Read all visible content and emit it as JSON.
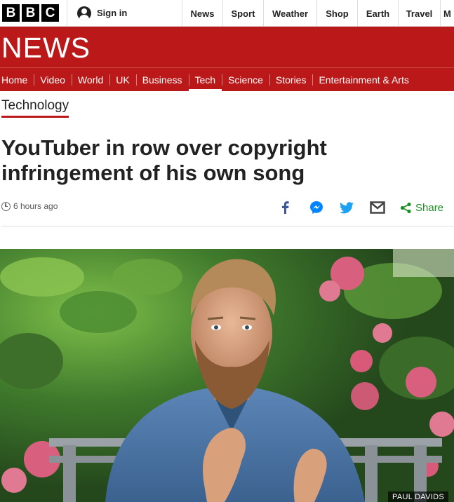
{
  "topbar": {
    "logo_letters": [
      "B",
      "B",
      "C"
    ],
    "signin_label": "Sign in",
    "links": [
      "News",
      "Sport",
      "Weather",
      "Shop",
      "Earth",
      "Travel",
      "M"
    ]
  },
  "banner": {
    "title": "NEWS",
    "color": "#bb1919"
  },
  "nav": {
    "items": [
      "Home",
      "Video",
      "World",
      "UK",
      "Business",
      "Tech",
      "Science",
      "Stories",
      "Entertainment & Arts"
    ],
    "active": "Tech"
  },
  "article": {
    "section": "Technology",
    "headline": "YouTuber in row over copyright infringement of his own song",
    "timestamp": "6 hours ago",
    "share_label": "Share",
    "share_icons": [
      "facebook-icon",
      "messenger-icon",
      "twitter-icon",
      "email-icon",
      "share-icon"
    ],
    "image_caption": "PAUL DAVIDS"
  }
}
